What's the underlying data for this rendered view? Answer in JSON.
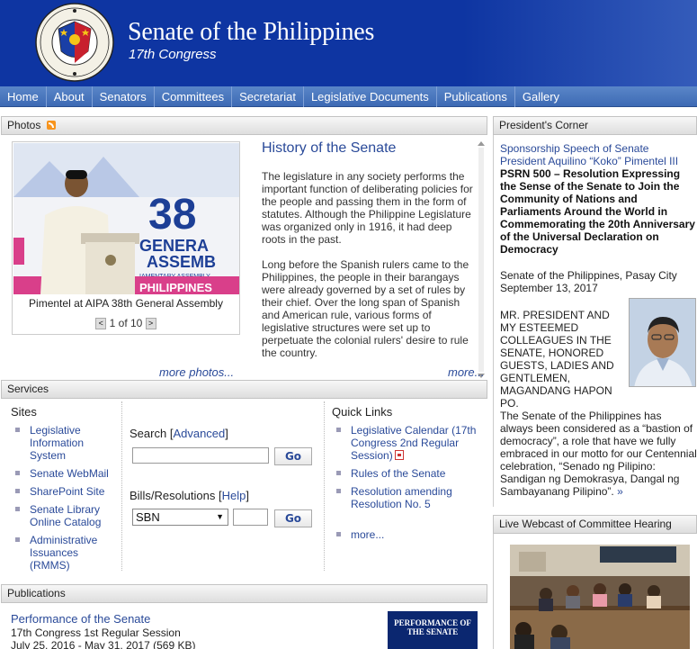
{
  "header": {
    "title": "Senate of the Philippines",
    "subtitle": "17th Congress",
    "seal_text": "SENADO NG PILIPINAS OFFICIAL SEAL"
  },
  "nav": {
    "items": [
      "Home",
      "About",
      "Senators",
      "Committees",
      "Secretariat",
      "Legislative Documents",
      "Publications",
      "Gallery"
    ]
  },
  "photos": {
    "title": "Photos",
    "caption": "Pimentel at AIPA 38th General Assembly",
    "pager": "1 of 10",
    "prev_icon": "<",
    "next_icon": ">",
    "more": "more photos..."
  },
  "history": {
    "title": "History of the Senate",
    "p1": "The legislature in any society performs the important function of deliberating policies for the people and passing them in the form of statutes. Although the Philippine Legislature was organized only in 1916, it had deep roots in the past.",
    "p2": "Long before the Spanish rulers came to the Philippines, the people in their barangays were already governed by a set of rules by their chief. Over the long span of Spanish and American rule, various forms of legislative structures were set up to perpetuate the colonial rulers' desire to rule the country.",
    "more": "more..."
  },
  "services": {
    "title": "Services",
    "sites_title": "Sites",
    "sites": [
      "Legislative Information System",
      "Senate WebMail",
      "SharePoint Site",
      "Senate Library Online Catalog",
      "Administrative Issuances (RMMS)"
    ],
    "search_label": "Search",
    "search_adv": "Advanced",
    "go": "Go",
    "bills_label": "Bills/Resolutions",
    "bills_help": "Help",
    "bills_selected": "SBN",
    "quick_title": "Quick Links",
    "quick_links": [
      "Legislative Calendar (17th Congress 2nd Regular Session)",
      "Rules of the Senate",
      "Resolution amending Resolution No. 5",
      "more..."
    ]
  },
  "publications": {
    "title": "Publications",
    "item_title": "Performance of the Senate",
    "item_line1": "17th Congress 1st Regular Session",
    "item_line2": "July 25, 2016 - May 31, 2017 (569 KB)",
    "cover_title": "PERFORMANCE OF THE SENATE"
  },
  "presidents_corner": {
    "title": "President's Corner",
    "link": "Sponsorship Speech of Senate President Aquilino “Koko” Pimentel III",
    "headline": "PSRN 500 – Resolution Expressing the Sense of the Senate to Join the Community of Nations and Parliaments Around the World in Commemorating the 20th Anniversary of the Universal Declaration on Democracy",
    "place": "Senate of the Philippines, Pasay City",
    "date": "September 13, 2017",
    "salutation": "MR. PRESIDENT AND MY ESTEEMED COLLEAGUES IN THE SENATE, HONORED GUESTS, LADIES AND GENTLEMEN, MAGANDANG HAPON PO.",
    "text": "The Senate of the Philippines has always been considered as a “bastion of democracy”, a role that have we fully embraced in our motto for our Centennial celebration, “Senado ng Pilipino: Sandigan ng Demokrasya, Dangal ng Sambayanang Pilipino”.",
    "more_icon": "»"
  },
  "webcast": {
    "title": "Live Webcast of Committee Hearing"
  },
  "colors": {
    "header_bg": "#0e35a2",
    "nav_bg": "#4a77bf",
    "link": "#2a4a99"
  }
}
